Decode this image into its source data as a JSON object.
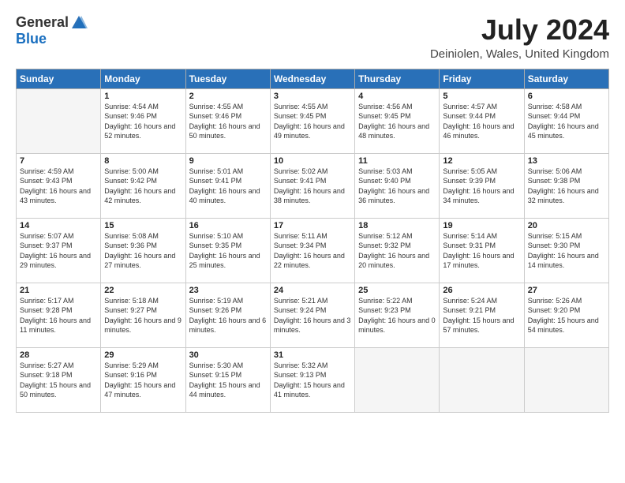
{
  "logo": {
    "general": "General",
    "blue": "Blue"
  },
  "title": {
    "month_year": "July 2024",
    "location": "Deiniolen, Wales, United Kingdom"
  },
  "weekdays": [
    "Sunday",
    "Monday",
    "Tuesday",
    "Wednesday",
    "Thursday",
    "Friday",
    "Saturday"
  ],
  "weeks": [
    [
      {
        "day": "",
        "sunrise": "",
        "sunset": "",
        "daylight": ""
      },
      {
        "day": "1",
        "sunrise": "Sunrise: 4:54 AM",
        "sunset": "Sunset: 9:46 PM",
        "daylight": "Daylight: 16 hours and 52 minutes."
      },
      {
        "day": "2",
        "sunrise": "Sunrise: 4:55 AM",
        "sunset": "Sunset: 9:46 PM",
        "daylight": "Daylight: 16 hours and 50 minutes."
      },
      {
        "day": "3",
        "sunrise": "Sunrise: 4:55 AM",
        "sunset": "Sunset: 9:45 PM",
        "daylight": "Daylight: 16 hours and 49 minutes."
      },
      {
        "day": "4",
        "sunrise": "Sunrise: 4:56 AM",
        "sunset": "Sunset: 9:45 PM",
        "daylight": "Daylight: 16 hours and 48 minutes."
      },
      {
        "day": "5",
        "sunrise": "Sunrise: 4:57 AM",
        "sunset": "Sunset: 9:44 PM",
        "daylight": "Daylight: 16 hours and 46 minutes."
      },
      {
        "day": "6",
        "sunrise": "Sunrise: 4:58 AM",
        "sunset": "Sunset: 9:44 PM",
        "daylight": "Daylight: 16 hours and 45 minutes."
      }
    ],
    [
      {
        "day": "7",
        "sunrise": "Sunrise: 4:59 AM",
        "sunset": "Sunset: 9:43 PM",
        "daylight": "Daylight: 16 hours and 43 minutes."
      },
      {
        "day": "8",
        "sunrise": "Sunrise: 5:00 AM",
        "sunset": "Sunset: 9:42 PM",
        "daylight": "Daylight: 16 hours and 42 minutes."
      },
      {
        "day": "9",
        "sunrise": "Sunrise: 5:01 AM",
        "sunset": "Sunset: 9:41 PM",
        "daylight": "Daylight: 16 hours and 40 minutes."
      },
      {
        "day": "10",
        "sunrise": "Sunrise: 5:02 AM",
        "sunset": "Sunset: 9:41 PM",
        "daylight": "Daylight: 16 hours and 38 minutes."
      },
      {
        "day": "11",
        "sunrise": "Sunrise: 5:03 AM",
        "sunset": "Sunset: 9:40 PM",
        "daylight": "Daylight: 16 hours and 36 minutes."
      },
      {
        "day": "12",
        "sunrise": "Sunrise: 5:05 AM",
        "sunset": "Sunset: 9:39 PM",
        "daylight": "Daylight: 16 hours and 34 minutes."
      },
      {
        "day": "13",
        "sunrise": "Sunrise: 5:06 AM",
        "sunset": "Sunset: 9:38 PM",
        "daylight": "Daylight: 16 hours and 32 minutes."
      }
    ],
    [
      {
        "day": "14",
        "sunrise": "Sunrise: 5:07 AM",
        "sunset": "Sunset: 9:37 PM",
        "daylight": "Daylight: 16 hours and 29 minutes."
      },
      {
        "day": "15",
        "sunrise": "Sunrise: 5:08 AM",
        "sunset": "Sunset: 9:36 PM",
        "daylight": "Daylight: 16 hours and 27 minutes."
      },
      {
        "day": "16",
        "sunrise": "Sunrise: 5:10 AM",
        "sunset": "Sunset: 9:35 PM",
        "daylight": "Daylight: 16 hours and 25 minutes."
      },
      {
        "day": "17",
        "sunrise": "Sunrise: 5:11 AM",
        "sunset": "Sunset: 9:34 PM",
        "daylight": "Daylight: 16 hours and 22 minutes."
      },
      {
        "day": "18",
        "sunrise": "Sunrise: 5:12 AM",
        "sunset": "Sunset: 9:32 PM",
        "daylight": "Daylight: 16 hours and 20 minutes."
      },
      {
        "day": "19",
        "sunrise": "Sunrise: 5:14 AM",
        "sunset": "Sunset: 9:31 PM",
        "daylight": "Daylight: 16 hours and 17 minutes."
      },
      {
        "day": "20",
        "sunrise": "Sunrise: 5:15 AM",
        "sunset": "Sunset: 9:30 PM",
        "daylight": "Daylight: 16 hours and 14 minutes."
      }
    ],
    [
      {
        "day": "21",
        "sunrise": "Sunrise: 5:17 AM",
        "sunset": "Sunset: 9:28 PM",
        "daylight": "Daylight: 16 hours and 11 minutes."
      },
      {
        "day": "22",
        "sunrise": "Sunrise: 5:18 AM",
        "sunset": "Sunset: 9:27 PM",
        "daylight": "Daylight: 16 hours and 9 minutes."
      },
      {
        "day": "23",
        "sunrise": "Sunrise: 5:19 AM",
        "sunset": "Sunset: 9:26 PM",
        "daylight": "Daylight: 16 hours and 6 minutes."
      },
      {
        "day": "24",
        "sunrise": "Sunrise: 5:21 AM",
        "sunset": "Sunset: 9:24 PM",
        "daylight": "Daylight: 16 hours and 3 minutes."
      },
      {
        "day": "25",
        "sunrise": "Sunrise: 5:22 AM",
        "sunset": "Sunset: 9:23 PM",
        "daylight": "Daylight: 16 hours and 0 minutes."
      },
      {
        "day": "26",
        "sunrise": "Sunrise: 5:24 AM",
        "sunset": "Sunset: 9:21 PM",
        "daylight": "Daylight: 15 hours and 57 minutes."
      },
      {
        "day": "27",
        "sunrise": "Sunrise: 5:26 AM",
        "sunset": "Sunset: 9:20 PM",
        "daylight": "Daylight: 15 hours and 54 minutes."
      }
    ],
    [
      {
        "day": "28",
        "sunrise": "Sunrise: 5:27 AM",
        "sunset": "Sunset: 9:18 PM",
        "daylight": "Daylight: 15 hours and 50 minutes."
      },
      {
        "day": "29",
        "sunrise": "Sunrise: 5:29 AM",
        "sunset": "Sunset: 9:16 PM",
        "daylight": "Daylight: 15 hours and 47 minutes."
      },
      {
        "day": "30",
        "sunrise": "Sunrise: 5:30 AM",
        "sunset": "Sunset: 9:15 PM",
        "daylight": "Daylight: 15 hours and 44 minutes."
      },
      {
        "day": "31",
        "sunrise": "Sunrise: 5:32 AM",
        "sunset": "Sunset: 9:13 PM",
        "daylight": "Daylight: 15 hours and 41 minutes."
      },
      {
        "day": "",
        "sunrise": "",
        "sunset": "",
        "daylight": ""
      },
      {
        "day": "",
        "sunrise": "",
        "sunset": "",
        "daylight": ""
      },
      {
        "day": "",
        "sunrise": "",
        "sunset": "",
        "daylight": ""
      }
    ]
  ]
}
